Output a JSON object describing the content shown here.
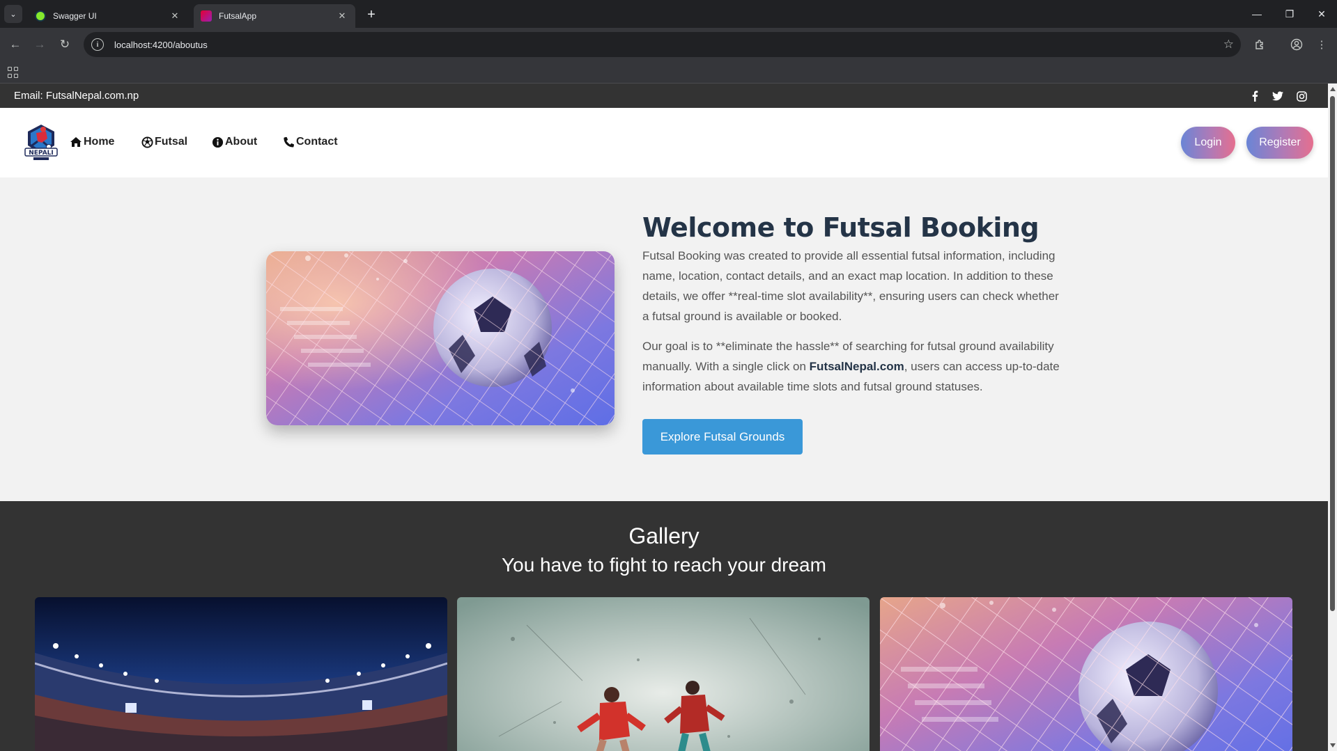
{
  "browser": {
    "tabs": [
      {
        "title": "Swagger UI",
        "active": false
      },
      {
        "title": "FutsalApp",
        "active": true
      }
    ],
    "url": "localhost:4200/aboutus"
  },
  "topbar": {
    "email": "Email: FutsalNepal.com.np",
    "social_icons": [
      "facebook-icon",
      "twitter-icon",
      "instagram-icon"
    ]
  },
  "navbar": {
    "logo_text": "NEPALI",
    "links": [
      {
        "label": "Home",
        "icon": "home-icon"
      },
      {
        "label": "Futsal",
        "icon": "soccer-ball-icon"
      },
      {
        "label": "About",
        "icon": "info-icon"
      },
      {
        "label": "Contact",
        "icon": "phone-icon"
      }
    ],
    "login_label": "Login",
    "register_label": "Register"
  },
  "about": {
    "title": "Welcome to Futsal Booking",
    "p1": "Futsal Booking was created to provide all essential futsal information, including name, location, contact details, and an exact map location. In addition to these details, we offer **real-time slot availability**, ensuring users can check whether a futsal ground is available or booked.",
    "p2_before": "Our goal is to **eliminate the hassle** of searching for futsal ground availability manually. With a single click on ",
    "p2_bold": "FutsalNepal.com",
    "p2_after": ", users can access up-to-date information about available time slots and futsal ground statuses.",
    "cta": "Explore Futsal Grounds"
  },
  "gallery": {
    "title": "Gallery",
    "subtitle": "You have to fight to reach your dream",
    "images": [
      "stadium",
      "players",
      "ball-in-net"
    ]
  },
  "colors": {
    "accent": "#3a98d8",
    "topbar": "#333333",
    "heading": "#243447"
  }
}
